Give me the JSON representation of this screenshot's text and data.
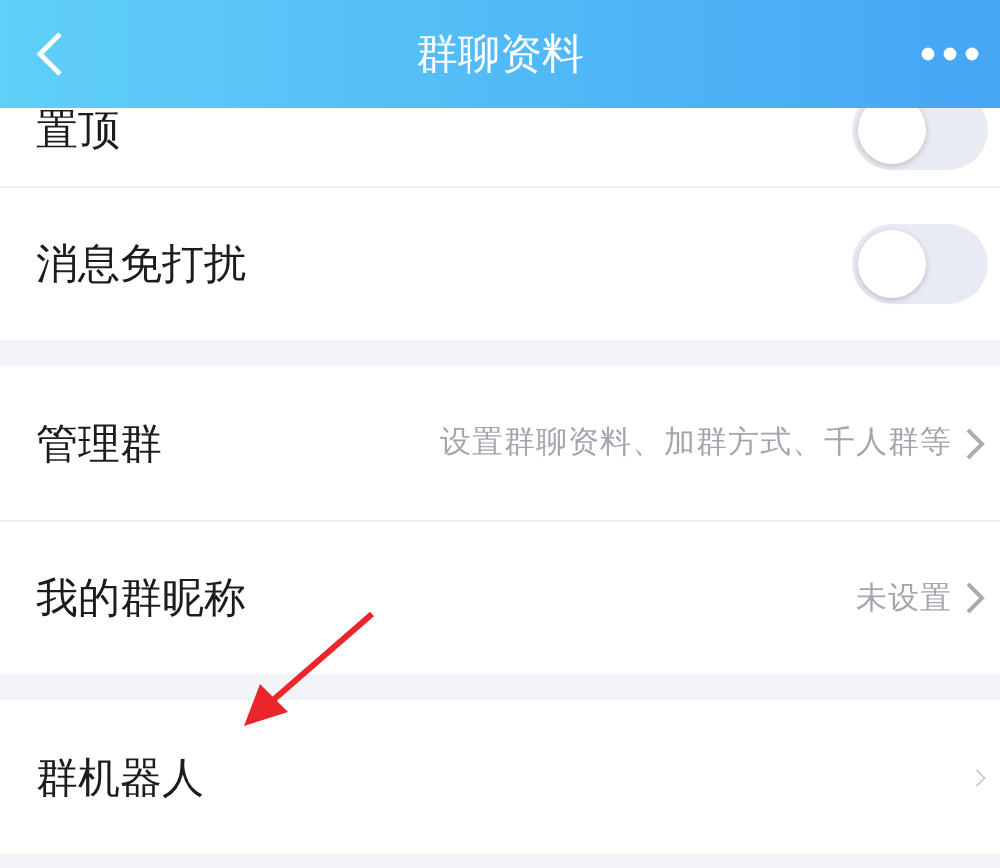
{
  "header": {
    "title": "群聊资料"
  },
  "sections": [
    {
      "rows": [
        {
          "kind": "toggle",
          "label": "置顶",
          "on": false
        },
        {
          "kind": "toggle",
          "label": "消息免打扰",
          "on": false
        }
      ]
    },
    {
      "rows": [
        {
          "kind": "link",
          "label": "管理群",
          "value": "设置群聊资料、加群方式、千人群等"
        },
        {
          "kind": "link",
          "label": "我的群昵称",
          "value": "未设置"
        }
      ]
    },
    {
      "rows": [
        {
          "kind": "link",
          "label": "群机器人",
          "small_chevron": true
        }
      ]
    }
  ],
  "annotation": {
    "kind": "arrow"
  }
}
